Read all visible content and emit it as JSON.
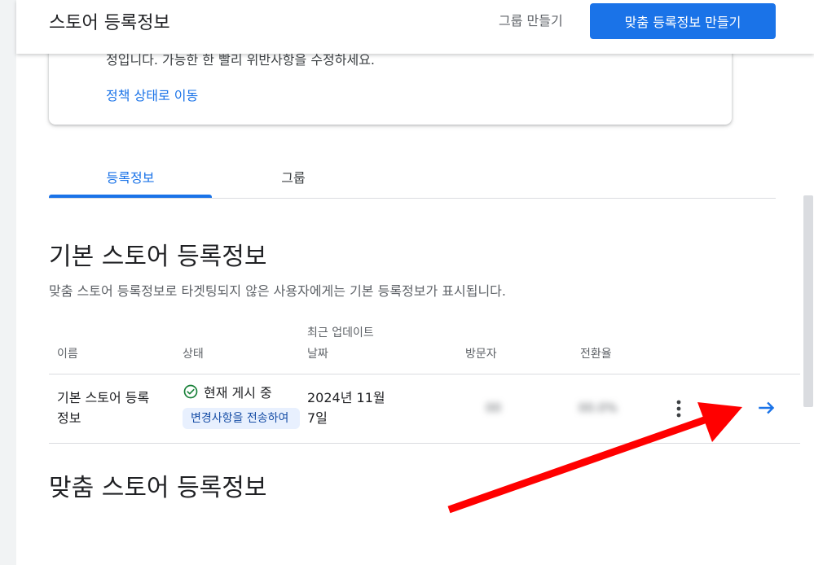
{
  "header": {
    "title": "스토어 등록정보",
    "create_group": "그룹 만들기",
    "create_custom": "맞춤 등록정보 만들기"
  },
  "policy_card": {
    "text": "정입니다. 가능한 한 빨리 위반사항을 수정하세요.",
    "link": "정책 상태로 이동"
  },
  "tabs": [
    {
      "label": "등록정보",
      "active": true
    },
    {
      "label": "그룹",
      "active": false
    }
  ],
  "default_section": {
    "title": "기본 스토어 등록정보",
    "description": "맞춤 스토어 등록정보로 타겟팅되지 않은 사용자에게는 기본 등록정보가 표시됩니다."
  },
  "table": {
    "columns": {
      "name": "이름",
      "status": "상태",
      "updated_line1": "최근 업데이트",
      "updated_line2": "날짜",
      "visitors": "방문자",
      "conversion": "전환율"
    },
    "row": {
      "name_line1": "기본 스토어 등록",
      "name_line2": "정보",
      "status": "현재 게시 중",
      "pending": "변경사항을 전송하여",
      "date_line1": "2024년 11월",
      "date_line2": "7일",
      "visitors": "00",
      "conversion": "00.0%"
    }
  },
  "custom_section": {
    "title": "맞춤 스토어 등록정보"
  },
  "colors": {
    "accent": "#1a73e8",
    "success": "#188038",
    "annotation": "#ff0000"
  },
  "icons": {
    "status": "check-circle-icon",
    "menu": "more-vert-icon",
    "open": "arrow-forward-icon"
  }
}
